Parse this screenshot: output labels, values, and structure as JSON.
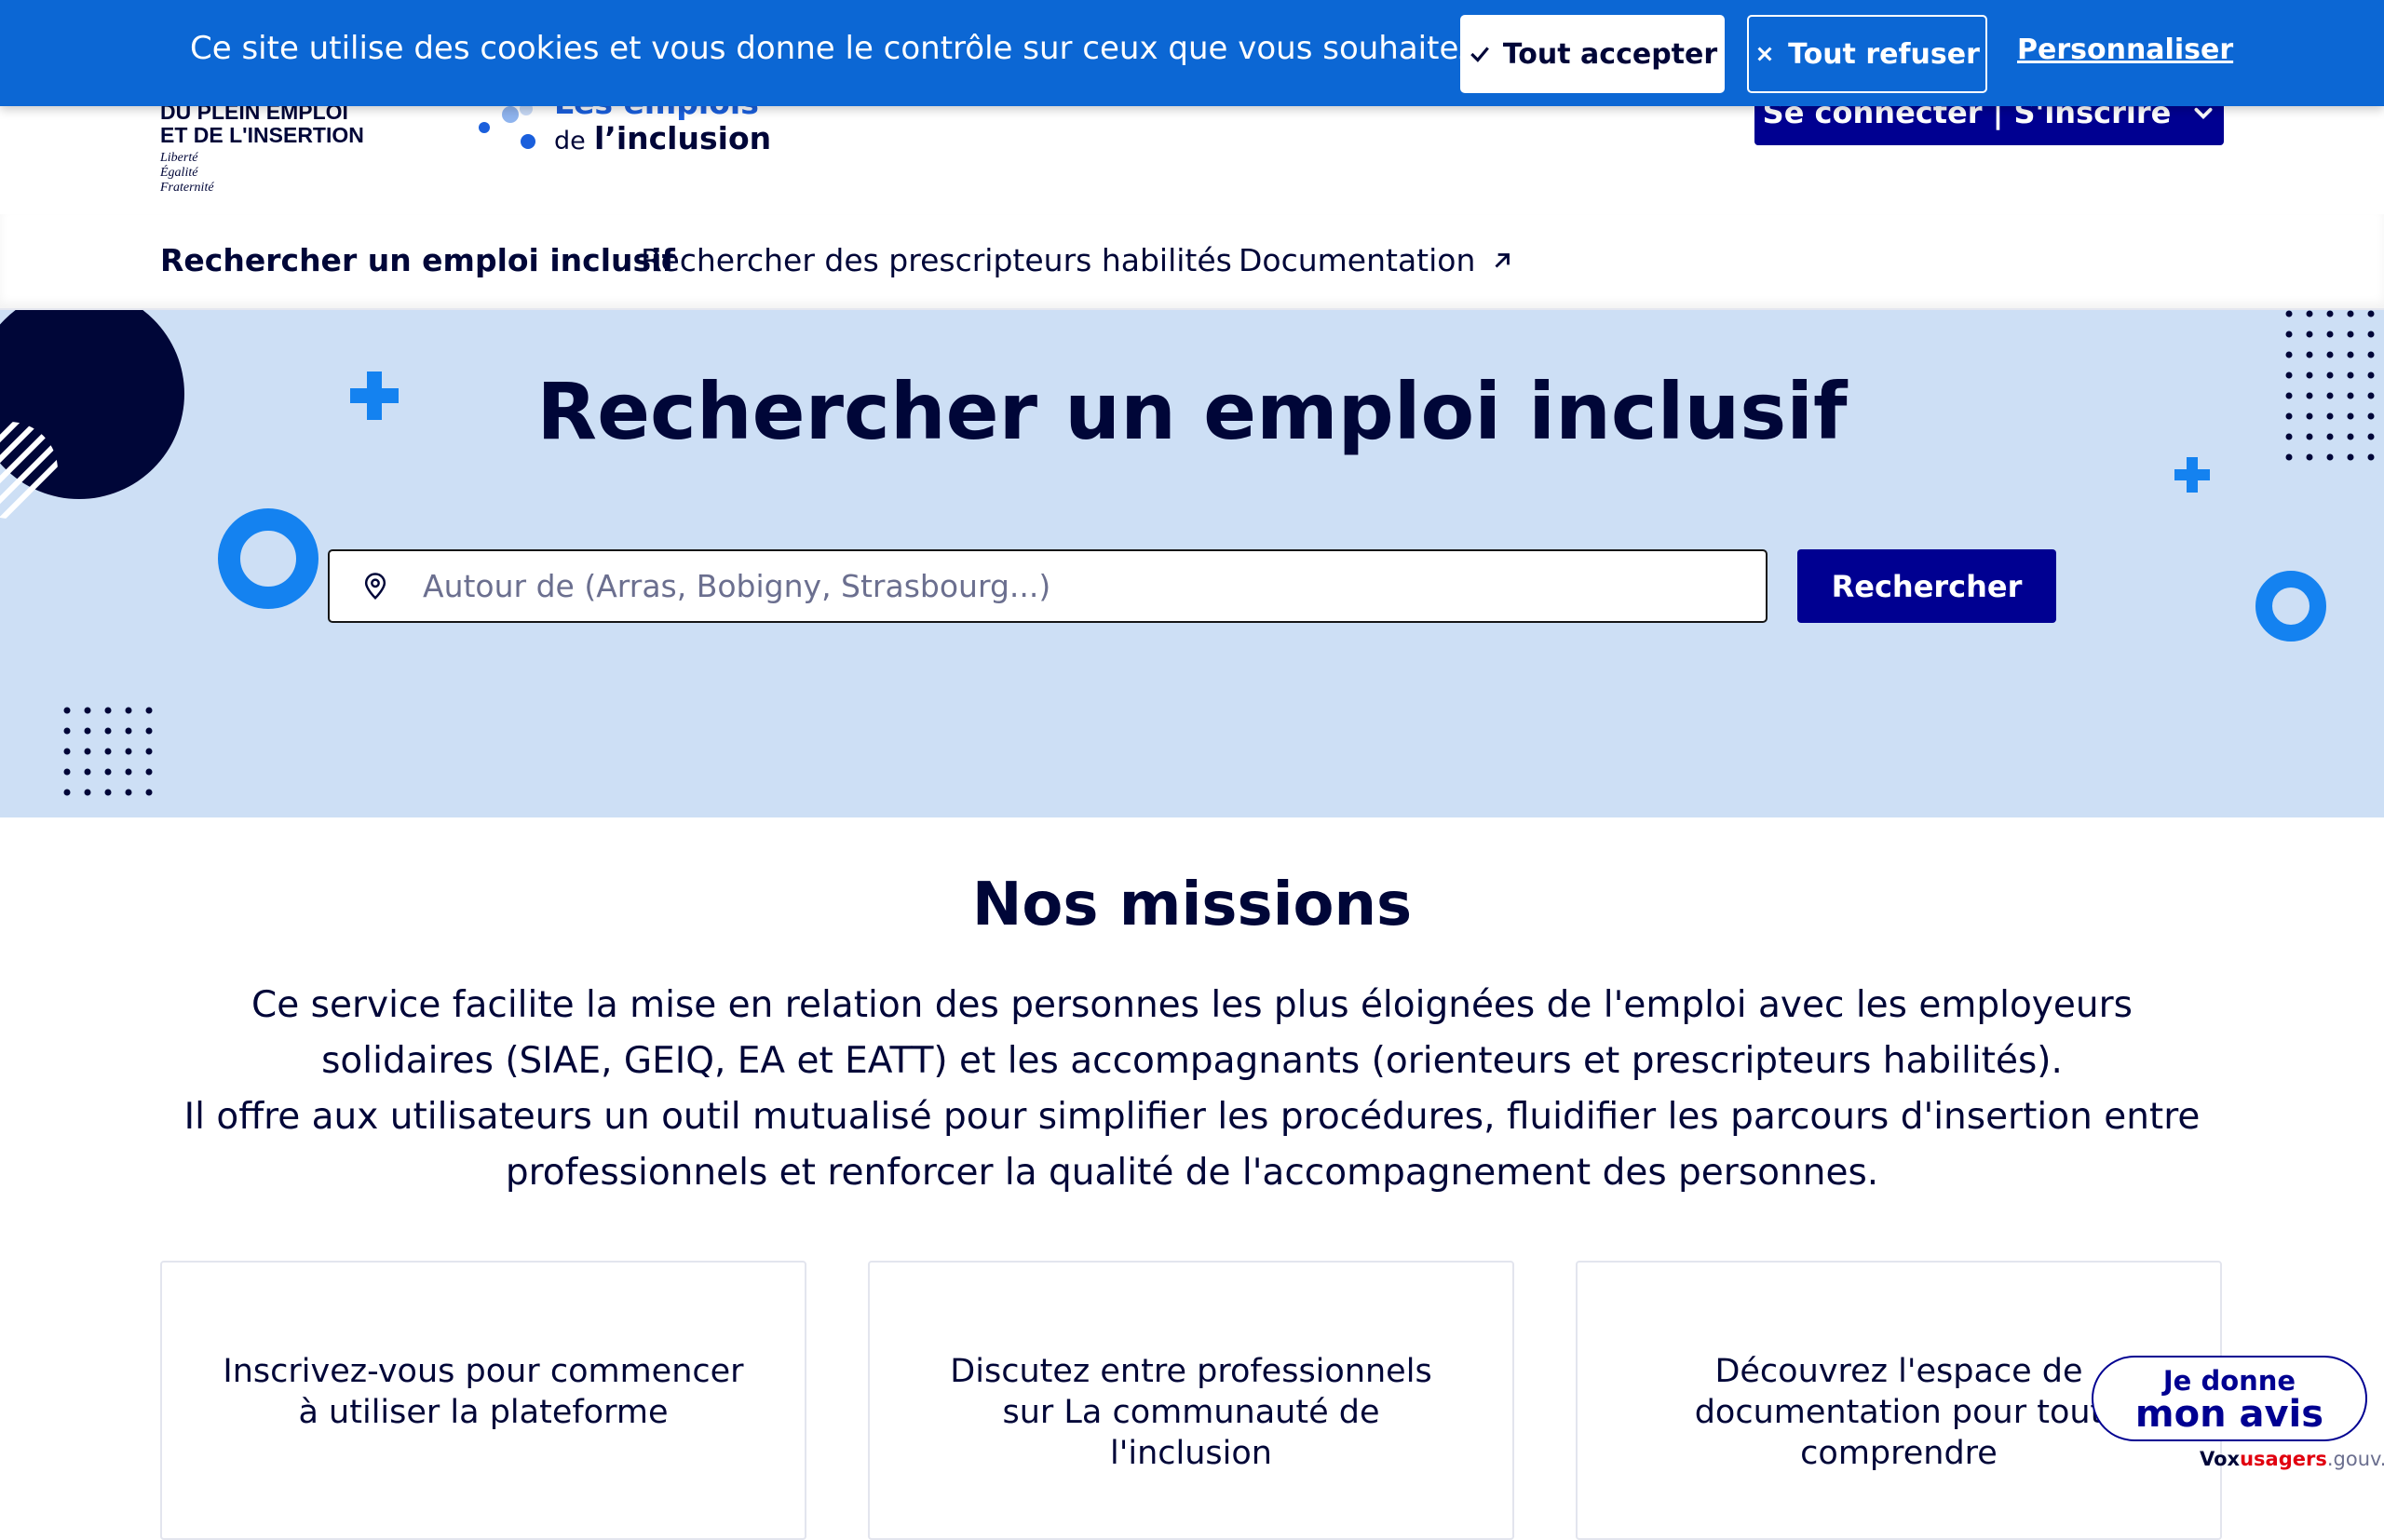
{
  "cookie_banner": {
    "text": "Ce site utilise des cookies et vous donne le contrôle sur ceux que vous souhaitez activer",
    "accept_label": "Tout accepter",
    "refuse_label": "Tout refuser",
    "customize_label": "Personnaliser"
  },
  "header": {
    "ministry_line1": "DU PLEIN EMPLOI",
    "ministry_line2": "ET DE L'INSERTION",
    "motto1": "Liberté",
    "motto2": "Égalité",
    "motto3": "Fraternité",
    "brand_line1": "Les emplois",
    "brand_line2a": "de",
    "brand_line2b": "l’inclusion",
    "login_label": "Se connecter | S'inscrire"
  },
  "nav": {
    "items": [
      {
        "label": "Rechercher un emploi inclusif"
      },
      {
        "label": "Rechercher des prescripteurs habilités"
      },
      {
        "label": "Documentation"
      }
    ]
  },
  "hero": {
    "title": "Rechercher un emploi inclusif",
    "search_placeholder": "Autour de (Arras, Bobigny, Strasbourg...)",
    "search_button": "Rechercher"
  },
  "missions": {
    "title": "Nos missions",
    "paragraph1": "Ce service facilite la mise en relation des personnes les plus éloignées de l'emploi avec les employeurs solidaires (SIAE, GEIQ, EA et EATT) et les accompagnants (orienteurs et prescripteurs habilités).",
    "paragraph2": "Il offre aux utilisateurs un outil mutualisé pour simplifier les procédures, fluidifier les parcours d'insertion entre professionnels et renforcer la qualité de l'accompagnement des personnes.",
    "cards": [
      {
        "text": "Inscrivez-vous pour commencer à utiliser la plateforme"
      },
      {
        "text": "Discutez entre professionnels sur La communauté de l'inclusion"
      },
      {
        "text": "Découvrez l'espace de documentation pour tout comprendre"
      }
    ]
  },
  "feedback": {
    "line1": "Je donne",
    "line2": "mon avis",
    "vox1": "Vox",
    "vox2": "usagers",
    "vox3": ".gouv.fr"
  },
  "colors": {
    "primary": "#000091",
    "banner": "#0c67d4",
    "hero_bg": "#cddff5",
    "text": "#000638",
    "accent_blue": "#1482f0"
  }
}
